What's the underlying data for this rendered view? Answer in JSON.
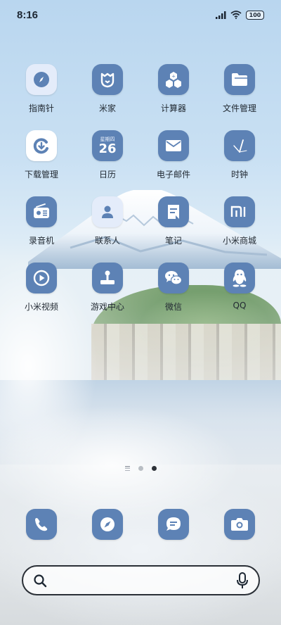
{
  "status_bar": {
    "time": "8:16",
    "battery_level": "100",
    "signal_icon": "signal-icon",
    "wifi_icon": "wifi-icon"
  },
  "apps": [
    {
      "label": "指南针",
      "icon": "compass-icon"
    },
    {
      "label": "米家",
      "icon": "mijia-icon"
    },
    {
      "label": "计算器",
      "icon": "calculator-icon"
    },
    {
      "label": "文件管理",
      "icon": "folder-icon"
    },
    {
      "label": "下载管理",
      "icon": "download-icon"
    },
    {
      "label": "日历",
      "icon": "calendar-icon",
      "badge_top": "星期四",
      "badge_date": "26"
    },
    {
      "label": "电子邮件",
      "icon": "mail-icon"
    },
    {
      "label": "时钟",
      "icon": "clock-icon"
    },
    {
      "label": "录音机",
      "icon": "recorder-icon"
    },
    {
      "label": "联系人",
      "icon": "contacts-icon"
    },
    {
      "label": "笔记",
      "icon": "notes-icon"
    },
    {
      "label": "小米商城",
      "icon": "mi-store-icon"
    },
    {
      "label": "小米视频",
      "icon": "video-icon"
    },
    {
      "label": "游戏中心",
      "icon": "game-center-icon"
    },
    {
      "label": "微信",
      "icon": "wechat-icon"
    },
    {
      "label": "QQ",
      "icon": "qq-icon"
    }
  ],
  "dock": [
    {
      "icon": "phone-icon"
    },
    {
      "icon": "browser-icon"
    },
    {
      "icon": "messages-icon"
    },
    {
      "icon": "camera-icon"
    }
  ],
  "page_indicator": {
    "pages": 3,
    "current": 3
  },
  "search": {
    "search_icon": "search-icon",
    "mic_icon": "mic-icon"
  },
  "colors": {
    "icon_bg": "#5d82b5",
    "icon_light_bg": "#e4ecfa",
    "text": "#222a33"
  }
}
